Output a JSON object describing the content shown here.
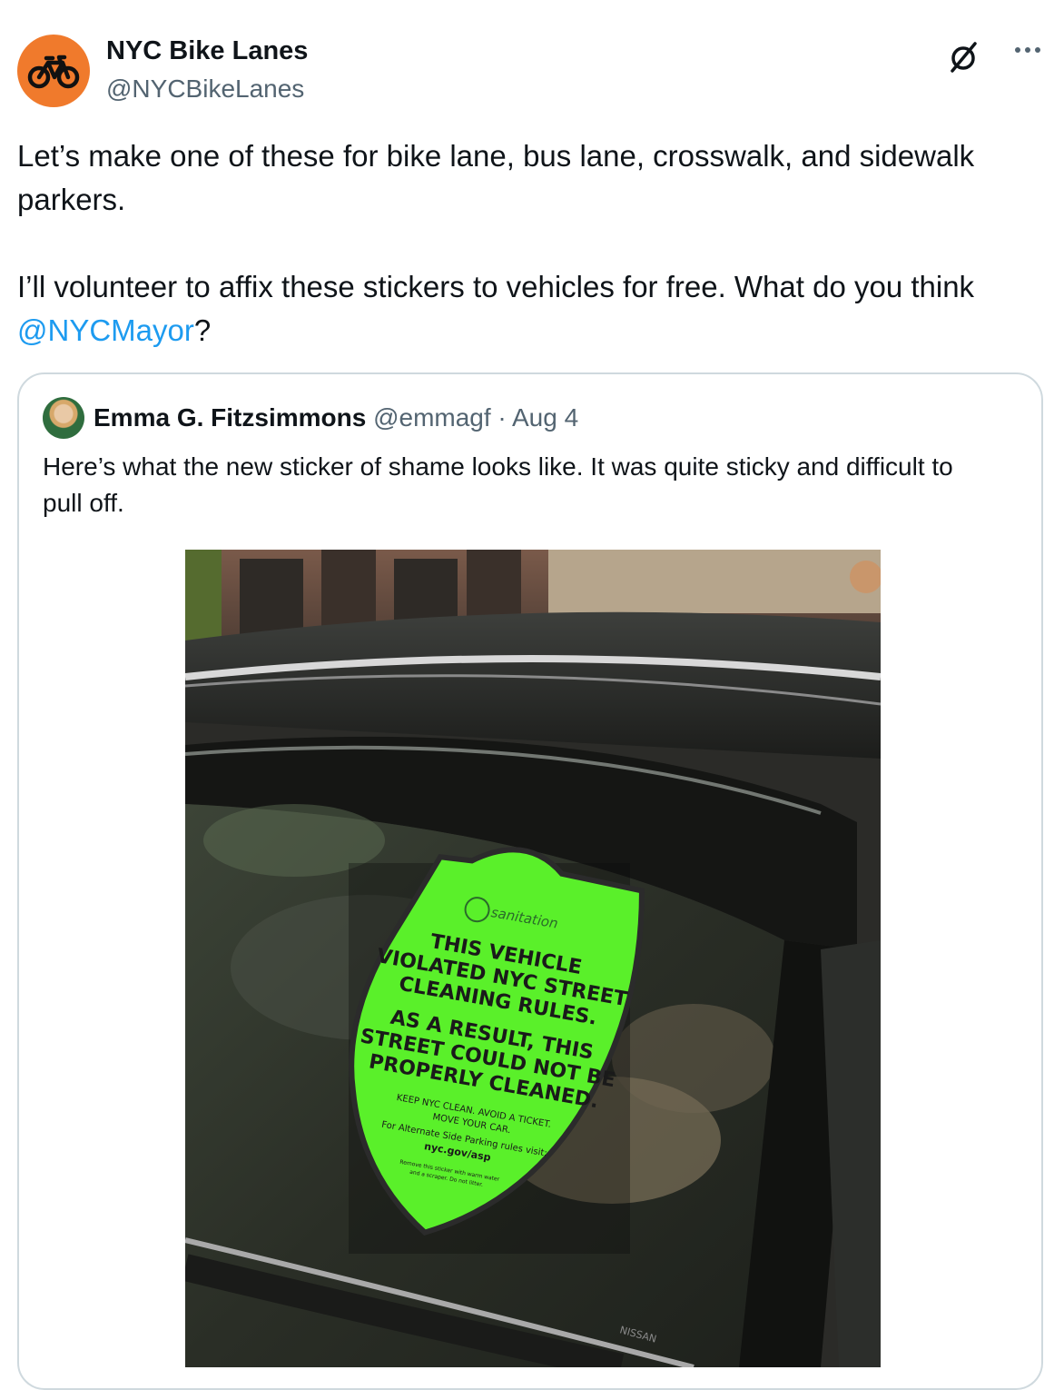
{
  "author": {
    "name": "NYC Bike Lanes",
    "handle": "@NYCBikeLanes",
    "avatar_icon": "bicycle-icon",
    "avatar_color": "#f07a2c"
  },
  "tweet": {
    "line1": "Let’s make one of these for bike lane, bus lane, crosswalk, and sidewalk parkers.",
    "line2_prefix": "I’ll volunteer to affix these stickers to vehicles for free. What do you think ",
    "mention": "@NYCMayor",
    "line2_suffix": "?"
  },
  "quote": {
    "name": "Emma G. Fitzsimmons",
    "handle": "@emmagf",
    "separator": " · ",
    "date": "Aug 4",
    "text": "Here’s what the new sticker of shame looks like. It was quite sticky and difficult to pull off."
  },
  "sticker": {
    "brand": "sanitation",
    "head1": "THIS VEHICLE",
    "head2": "VIOLATED NYC STREET",
    "head3": "CLEANING RULES.",
    "head4": "AS A RESULT, THIS",
    "head5": "STREET COULD NOT BE",
    "head6": "PROPERLY CLEANED.",
    "small1": "KEEP NYC CLEAN. AVOID A TICKET.",
    "small2": "MOVE YOUR CAR.",
    "small3": "For Alternate Side Parking rules visit:",
    "url": "nyc.gov/asp",
    "tiny1": "Remove this sticker with warm water",
    "tiny2": "and a scraper. Do not litter.",
    "color": "#5af02a"
  },
  "car_badge": "NISSAN",
  "colors": {
    "link": "#1d9bf0",
    "secondary_text": "#536471",
    "border": "#cfd9de"
  }
}
